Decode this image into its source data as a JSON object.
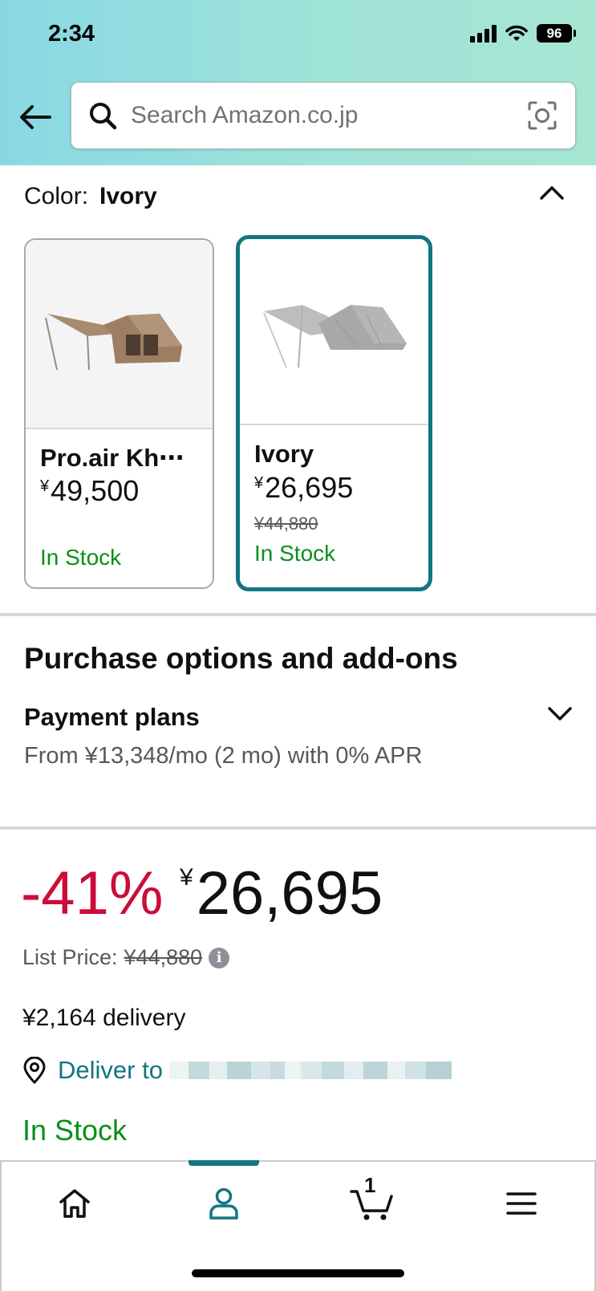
{
  "status_bar": {
    "time": "2:34",
    "battery": "96"
  },
  "search": {
    "placeholder": "Search Amazon.co.jp"
  },
  "color_selector": {
    "label": "Color:",
    "value": "Ivory",
    "options": [
      {
        "name": "Pro.air Kh⋯",
        "currency": "¥",
        "price": "49,500",
        "list_price": "",
        "stock": "In Stock",
        "selected": false
      },
      {
        "name": "Ivory",
        "currency": "¥",
        "price": "26,695",
        "list_price": "¥44,880",
        "stock": "In Stock",
        "selected": true
      }
    ]
  },
  "purchase_options": {
    "title": "Purchase options and add-ons",
    "payment_title": "Payment plans",
    "payment_desc": "From ¥13,348/mo (2 mo) with 0% APR"
  },
  "price_block": {
    "discount": "-41%",
    "currency": "¥",
    "price": "26,695",
    "list_price_label": "List Price:",
    "list_price": "¥44,880",
    "delivery": "¥2,164 delivery",
    "deliver_to": "Deliver to",
    "stock": "In Stock"
  },
  "tabbar": {
    "cart_count": "1",
    "active_tab": "account"
  },
  "colors": {
    "accent": "#127582",
    "discount": "#cc0c39",
    "in_stock": "#0b8f1a"
  },
  "icons": [
    "back-arrow-icon",
    "search-icon",
    "camera-icon",
    "chevron-up-icon",
    "chevron-down-icon",
    "info-icon",
    "location-pin-icon",
    "home-icon",
    "account-icon",
    "cart-icon",
    "menu-icon"
  ]
}
